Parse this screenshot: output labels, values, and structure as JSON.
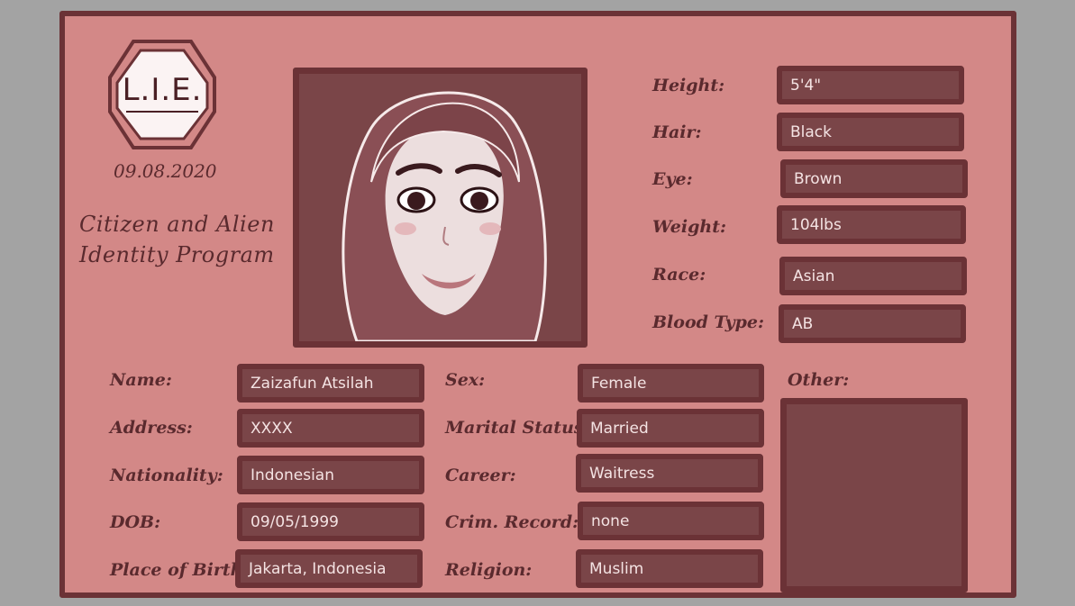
{
  "card": {
    "logo_text": "L.I.E.",
    "date": "09.08.2020",
    "program_line1": "Citizen and Alien",
    "program_line2": "Identity Program"
  },
  "physical": [
    {
      "label": "Height:",
      "value": "5'4\""
    },
    {
      "label": "Hair:",
      "value": "Black"
    },
    {
      "label": "Eye:",
      "value": "Brown"
    },
    {
      "label": "Weight:",
      "value": "104lbs"
    },
    {
      "label": "Race:",
      "value": "Asian"
    },
    {
      "label": "Blood Type:",
      "value": "AB"
    }
  ],
  "personal": [
    {
      "label": "Name:",
      "value": "Zaizafun Atsilah"
    },
    {
      "label": "Address:",
      "value": "XXXX"
    },
    {
      "label": "Nationality:",
      "value": "Indonesian"
    },
    {
      "label": "DOB:",
      "value": "09/05/1999"
    },
    {
      "label": "Place of Birth:",
      "value": "Jakarta, Indonesia"
    }
  ],
  "status": [
    {
      "label": "Sex:",
      "value": "Female"
    },
    {
      "label": "Marital Status:",
      "value": "Married"
    },
    {
      "label": "Career:",
      "value": "Waitress"
    },
    {
      "label": "Crim. Record:",
      "value": "none"
    },
    {
      "label": "Religion:",
      "value": "Muslim"
    }
  ],
  "other": {
    "label": "Other:",
    "value": ""
  },
  "colors": {
    "card": "#d38887",
    "border": "#6b3236",
    "field": "#7a4548",
    "label_text": "#5a2a2e",
    "field_text": "#f4e3e3"
  }
}
